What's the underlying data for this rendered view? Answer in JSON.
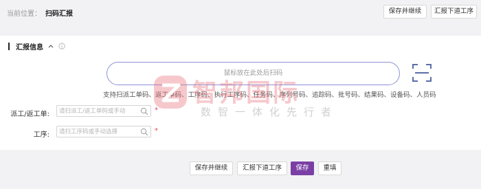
{
  "breadcrumb": {
    "label": "当前位置：",
    "current": "扫码汇报"
  },
  "header_actions": {
    "save_continue": "保存并继续",
    "report_next": "汇报下道工序"
  },
  "section": {
    "title": "汇报信息"
  },
  "scan": {
    "placeholder": "鼠标放在此处后扫码",
    "support_text": "支持扫派工单码、返工单码、工序码、执行工序码、任务码、序列号码、追踪码、批号码、结果码、设备码、人员码"
  },
  "form": {
    "dispatch_label": "派工/返工单:",
    "dispatch_placeholder": "请扫派工/返工单码或手动",
    "process_label": "工序:",
    "process_placeholder": "请扫工序码或手动选择"
  },
  "watermark": {
    "title": "智邦国际",
    "subtitle": "数智一体化先行者"
  },
  "footer_actions": {
    "save_continue": "保存并继续",
    "report_next": "汇报下道工序",
    "save": "保存",
    "reset": "重填"
  },
  "colors": {
    "primary": "#7a3fa4",
    "scan_border": "#8c8fd6",
    "required": "#e0405a"
  }
}
